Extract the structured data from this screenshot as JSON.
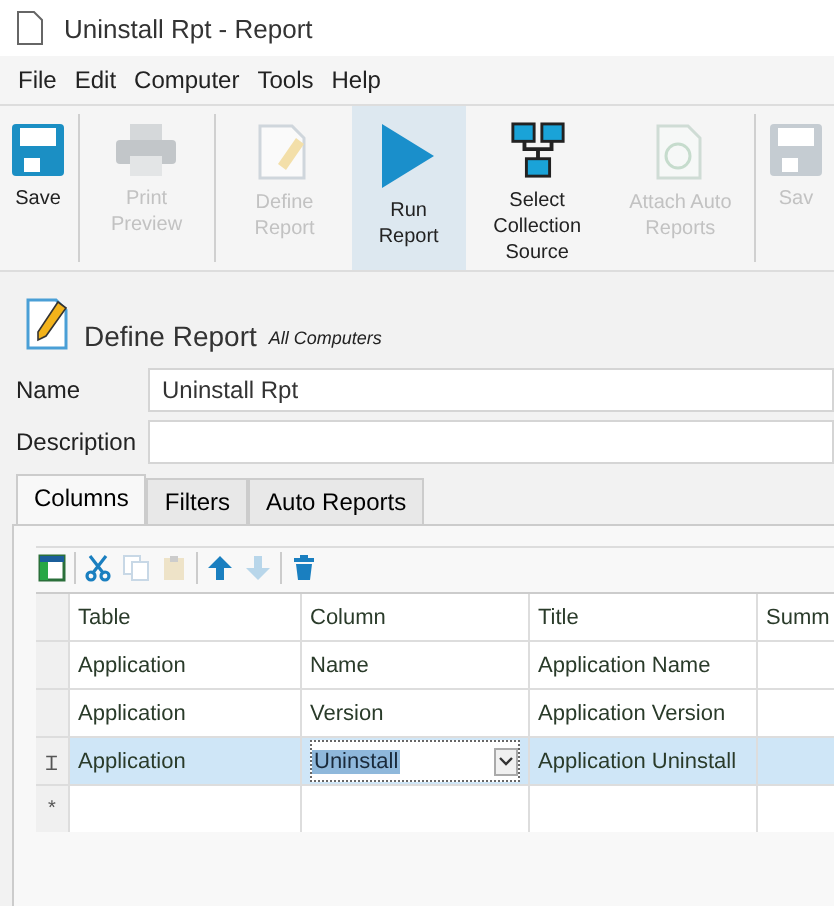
{
  "window": {
    "title": "Uninstall Rpt - Report"
  },
  "menu": [
    "File",
    "Edit",
    "Computer",
    "Tools",
    "Help"
  ],
  "toolbar": [
    [
      {
        "kind": "save",
        "label": "Save",
        "disabled": false,
        "highlighted": false
      }
    ],
    [
      {
        "kind": "print",
        "label": "Print Preview",
        "disabled": true,
        "highlighted": false
      }
    ],
    [
      {
        "kind": "define",
        "label": "Define Report",
        "disabled": true,
        "highlighted": false
      },
      {
        "kind": "run",
        "label": "Run Report",
        "disabled": false,
        "highlighted": true
      },
      {
        "kind": "network",
        "label": "Select Collection Source",
        "disabled": false,
        "highlighted": false
      },
      {
        "kind": "attach",
        "label": "Attach Auto Reports",
        "disabled": true,
        "highlighted": false
      }
    ],
    [
      {
        "kind": "save",
        "label": "Sav",
        "disabled": true,
        "highlighted": false
      }
    ]
  ],
  "header": {
    "title": "Define Report",
    "subtitle": "All Computers"
  },
  "fields": [
    {
      "label": "Name",
      "value": "Uninstall Rpt"
    },
    {
      "label": "Description"
    }
  ],
  "tabs": [
    {
      "label": "Columns",
      "selected": true
    },
    {
      "label": "Filters",
      "selected": false
    },
    {
      "label": "Auto Reports",
      "selected": false
    }
  ],
  "grid_tools": [
    [
      {
        "kind": "columns",
        "disabled": false
      }
    ],
    [
      {
        "kind": "cut",
        "disabled": false
      },
      {
        "kind": "copy",
        "disabled": true
      },
      {
        "kind": "paste",
        "disabled": true
      }
    ],
    [
      {
        "kind": "up",
        "disabled": false
      },
      {
        "kind": "down",
        "disabled": true
      }
    ],
    [
      {
        "kind": "delete",
        "disabled": false
      }
    ]
  ],
  "table": {
    "columns": [
      "Table",
      "Column",
      "Title",
      "Summ"
    ],
    "rows": [
      {
        "indicator": "",
        "cells": [
          "Application",
          "Name",
          "Application Name",
          ""
        ],
        "selected": false,
        "editing": false
      },
      {
        "indicator": "",
        "cells": [
          "Application",
          "Version",
          "Application Version",
          ""
        ],
        "selected": false,
        "editing": false
      },
      {
        "indicator": "Ɪ",
        "cells": [
          "Application",
          "Uninstall",
          "Application Uninstall",
          ""
        ],
        "selected": true,
        "editing": true
      }
    ],
    "new_row_indicator": "*"
  }
}
